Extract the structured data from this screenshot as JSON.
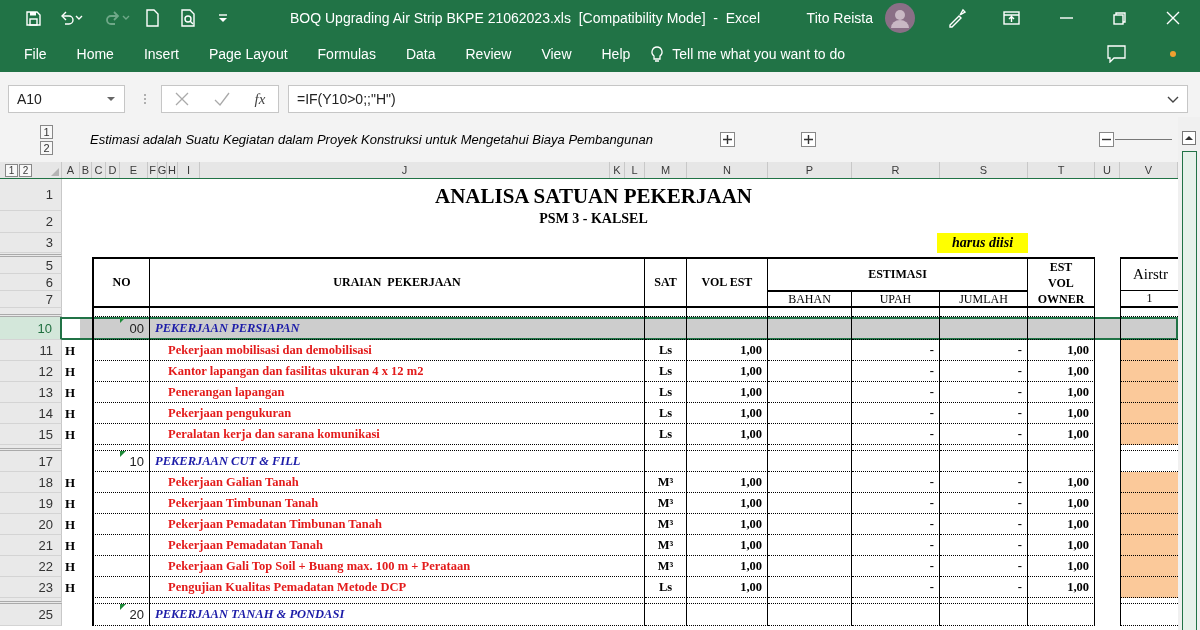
{
  "title_bar": {
    "title": "BOQ Upgrading Air Strip BKPE 21062023.xls  [Compatibility Mode]  -  Excel",
    "user": "Tito Reista"
  },
  "ribbon": {
    "tabs": [
      {
        "label": "File",
        "selected": false
      },
      {
        "label": "Home",
        "selected": false
      },
      {
        "label": "Insert",
        "selected": false
      },
      {
        "label": "Page Layout",
        "selected": false
      },
      {
        "label": "Formulas",
        "selected": false
      },
      {
        "label": "Data",
        "selected": false
      },
      {
        "label": "Review",
        "selected": false
      },
      {
        "label": "View",
        "selected": false
      },
      {
        "label": "Help",
        "selected": false
      }
    ],
    "tell_me": "Tell me what you want to do"
  },
  "formula_bar": {
    "name_box": "A10",
    "function_label": "fx",
    "formula": "=IF(Y10>0;;\"H\")"
  },
  "outline": {
    "column_levels": [
      "1",
      "2"
    ],
    "note": "Estimasi adalah Suatu Kegiatan dalam Proyek Konstruksi untuk Mengetahui Biaya Pembangunan",
    "groups": [
      {
        "expanded": false
      },
      {
        "expanded": false
      },
      {
        "expanded": true
      }
    ]
  },
  "row_levels": [
    "1",
    "2"
  ],
  "columns": [
    "A",
    "B",
    "C",
    "D",
    "E",
    "F",
    "G",
    "H",
    "I",
    "J",
    "K",
    "L",
    "M",
    "N",
    "P",
    "R",
    "S",
    "T",
    "U",
    "V"
  ],
  "sheet": {
    "title": "ANALISA SATUAN PEKERJAAN",
    "subtitle": "PSM 3 - KALSEL",
    "note": "harus diisi",
    "header_rows": [
      "1",
      "2",
      "3",
      "5",
      "6",
      "7"
    ],
    "header": {
      "no": "NO",
      "description": "URAIAN  PEKERJAAN",
      "unit": "SAT",
      "volume": "VOL EST",
      "estimate": "ESTIMASI",
      "estimate_columns": [
        "BAHAN",
        "UPAH",
        "JUMLAH"
      ],
      "owner": [
        "EST",
        "VOL",
        "OWNER"
      ],
      "airstrip": "Airstr",
      "airstrip_number": "1"
    },
    "rows": [
      {
        "row": "10",
        "kind": "section",
        "selected": true,
        "hidden_before": true,
        "code": "00",
        "description": "PEKERJAAN PERSIAPAN"
      },
      {
        "row": "11",
        "kind": "item",
        "selected": false,
        "hidden_before": false,
        "flag": "H",
        "description": "Pekerjaan mobilisasi dan demobilisasi",
        "unit": "Ls",
        "volume": "1,00",
        "upah": "-",
        "jumlah": "-",
        "owner": "1,00"
      },
      {
        "row": "12",
        "kind": "item",
        "selected": false,
        "hidden_before": false,
        "flag": "H",
        "description": "Kantor lapangan dan fasilitas ukuran 4 x 12 m2",
        "unit": "Ls",
        "volume": "1,00",
        "upah": "-",
        "jumlah": "-",
        "owner": "1,00"
      },
      {
        "row": "13",
        "kind": "item",
        "selected": false,
        "hidden_before": false,
        "flag": "H",
        "description": "Penerangan lapangan",
        "unit": "Ls",
        "volume": "1,00",
        "upah": "-",
        "jumlah": "-",
        "owner": "1,00"
      },
      {
        "row": "14",
        "kind": "item",
        "selected": false,
        "hidden_before": false,
        "flag": "H",
        "description": "Pekerjaan pengukuran",
        "unit": "Ls",
        "volume": "1,00",
        "upah": "-",
        "jumlah": "-",
        "owner": "1,00"
      },
      {
        "row": "15",
        "kind": "item",
        "selected": false,
        "hidden_before": false,
        "flag": "H",
        "description": "Peralatan kerja dan sarana komunikasi",
        "unit": "Ls",
        "volume": "1,00",
        "upah": "-",
        "jumlah": "-",
        "owner": "1,00"
      },
      {
        "row": "17",
        "kind": "section",
        "selected": false,
        "hidden_before": true,
        "code": "10",
        "description": "PEKERJAAN CUT & FILL"
      },
      {
        "row": "18",
        "kind": "item",
        "selected": false,
        "hidden_before": false,
        "flag": "H",
        "description": "Pekerjaan Galian Tanah",
        "unit": "M³",
        "volume": "1,00",
        "upah": "-",
        "jumlah": "-",
        "owner": "1,00"
      },
      {
        "row": "19",
        "kind": "item",
        "selected": false,
        "hidden_before": false,
        "flag": "H",
        "description": "Pekerjaan Timbunan Tanah",
        "unit": "M³",
        "volume": "1,00",
        "upah": "-",
        "jumlah": "-",
        "owner": "1,00"
      },
      {
        "row": "20",
        "kind": "item",
        "selected": false,
        "hidden_before": false,
        "flag": "H",
        "description": "Pekerjaan Pemadatan Timbunan Tanah",
        "unit": "M³",
        "volume": "1,00",
        "upah": "-",
        "jumlah": "-",
        "owner": "1,00"
      },
      {
        "row": "21",
        "kind": "item",
        "selected": false,
        "hidden_before": false,
        "flag": "H",
        "description": "Pekerjaan Pemadatan Tanah",
        "unit": "M³",
        "volume": "1,00",
        "upah": "-",
        "jumlah": "-",
        "owner": "1,00"
      },
      {
        "row": "22",
        "kind": "item",
        "selected": false,
        "hidden_before": false,
        "flag": "H",
        "description": "Pekerjaan Gali Top Soil + Buang max. 100 m + Perataan",
        "unit": "M³",
        "volume": "1,00",
        "upah": "-",
        "jumlah": "-",
        "owner": "1,00"
      },
      {
        "row": "23",
        "kind": "item",
        "selected": false,
        "hidden_before": false,
        "flag": "H",
        "description": "Pengujian Kualitas Pemadatan Metode DCP",
        "unit": "Ls",
        "volume": "1,00",
        "upah": "-",
        "jumlah": "-",
        "owner": "1,00"
      },
      {
        "row": "25",
        "kind": "section",
        "selected": false,
        "hidden_before": true,
        "code": "20",
        "description": "PEKERJAAN TANAH & PONDASI"
      }
    ]
  }
}
